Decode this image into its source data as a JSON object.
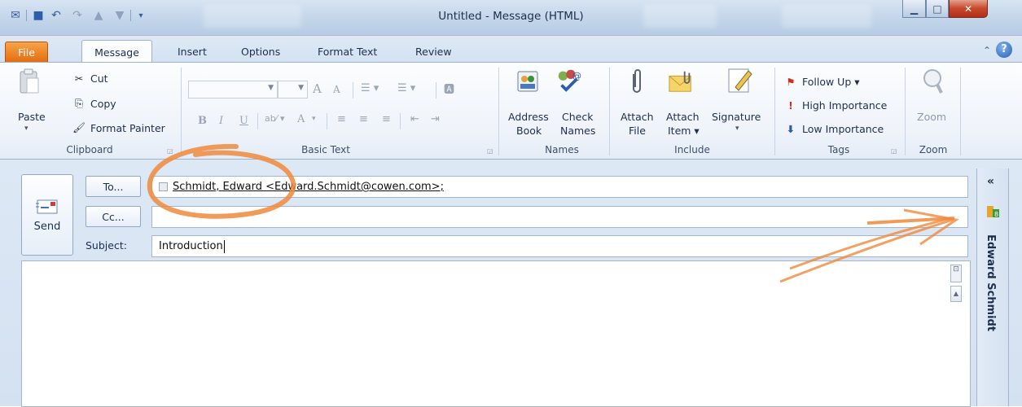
{
  "window": {
    "title": "Untitled  -  Message (HTML)"
  },
  "tabs": [
    {
      "label": "File"
    },
    {
      "label": "Message"
    },
    {
      "label": "Insert"
    },
    {
      "label": "Options"
    },
    {
      "label": "Format Text"
    },
    {
      "label": "Review"
    }
  ],
  "clipboard": {
    "paste": "Paste",
    "cut": "Cut",
    "copy": "Copy",
    "format_painter": "Format Painter",
    "group_label": "Clipboard"
  },
  "basic_text": {
    "bold": "B",
    "italic": "I",
    "underline": "U",
    "grow_font": "A",
    "shrink_font": "A",
    "font_color": "A",
    "group_label": "Basic Text"
  },
  "names": {
    "address_book_line1": "Address",
    "address_book_line2": "Book",
    "check_names_line1": "Check",
    "check_names_line2": "Names",
    "group_label": "Names"
  },
  "include": {
    "attach_file_line1": "Attach",
    "attach_file_line2": "File",
    "attach_item_line1": "Attach",
    "attach_item_line2": "Item ▾",
    "signature": "Signature",
    "group_label": "Include"
  },
  "tags": {
    "follow_up": "Follow Up ▾",
    "high_importance": "High Importance",
    "low_importance": "Low Importance",
    "group_label": "Tags"
  },
  "zoom": {
    "button": "Zoom",
    "group_label": "Zoom"
  },
  "compose": {
    "send": "Send",
    "to_button": "To...",
    "cc_button": "Cc...",
    "subject_label": "Subject:",
    "to_value": "Schmidt, Edward <Edward.Schmidt@cowen.com>;",
    "cc_value": "",
    "subject_value": "Introduction"
  },
  "people_pane": {
    "name": "Edward Schmidt",
    "collapse": "«"
  },
  "colors": {
    "file_tab": "#e36b0e",
    "annotation": "#f08a3c",
    "accent": "#2a5db0"
  }
}
